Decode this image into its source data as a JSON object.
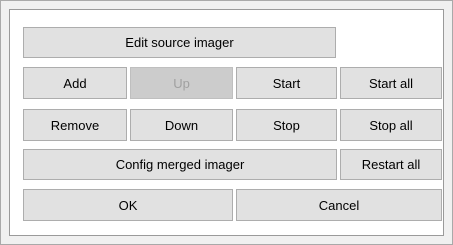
{
  "buttons": {
    "edit_source_imager": "Edit source imager",
    "add": "Add",
    "up": "Up",
    "start": "Start",
    "start_all": "Start all",
    "remove": "Remove",
    "down": "Down",
    "stop": "Stop",
    "stop_all": "Stop all",
    "config_merged_imager": "Config merged imager",
    "restart_all": "Restart all",
    "ok": "OK",
    "cancel": "Cancel"
  }
}
